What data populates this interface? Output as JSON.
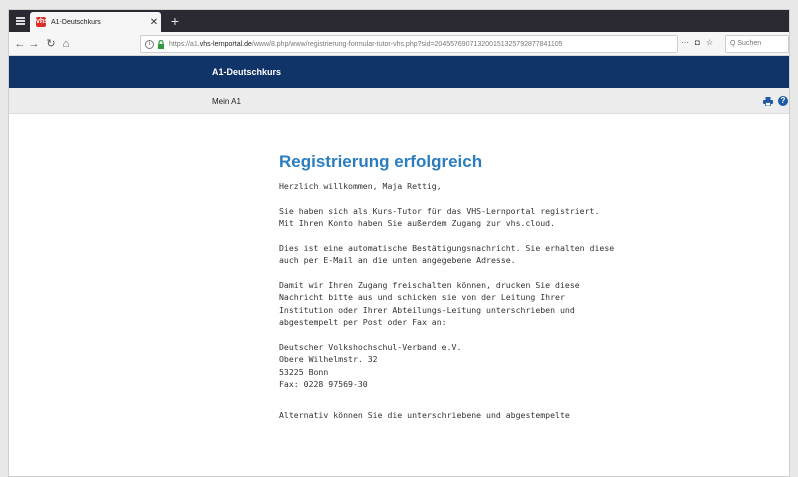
{
  "browser": {
    "tab_title": "A1-Deutschkurs",
    "favicon_text": "vhs",
    "url_prefix": "https://a1.",
    "url_domain": "vhs-lernportal.de",
    "url_rest": "/www/8.php/www/registrierung-formular-tutor-vhs.php?sid=204557690713200151325792877841105",
    "search_placeholder": "Q  Suchen",
    "icons": {
      "menu": "menu-icon",
      "new_tab": "plus-icon",
      "back": "back-arrow-icon",
      "forward": "forward-arrow-icon",
      "reload": "reload-icon",
      "home": "home-icon",
      "page_info": "info-icon",
      "secure": "lock-icon",
      "more": "ellipsis-icon",
      "pocket": "pocket-icon",
      "bookmark": "star-icon"
    }
  },
  "site": {
    "title": "A1-Deutschkurs",
    "nav_link": "Mein A1",
    "header_color": "#113468",
    "accent_color": "#2a7dc0",
    "icons": {
      "print": "print-icon",
      "help": "help-icon"
    }
  },
  "page": {
    "heading": "Registrierung erfolgreich",
    "greeting": "Herzlich willkommen, Maja Rettig,",
    "paragraph1": "Sie haben sich als Kurs-Tutor für das VHS-Lernportal registriert.\nMit Ihren Konto haben Sie außerdem Zugang zur vhs.cloud.",
    "paragraph2": "Dies ist eine automatische Bestätigungsnachricht. Sie erhalten diese\nauch per E-Mail an die unten angegebene Adresse.",
    "paragraph3": "Damit wir Ihren Zugang freischalten können, drucken Sie diese\nNachricht bitte aus und schicken sie von der Leitung Ihrer\nInstitution oder Ihrer Abteilungs-Leitung unterschrieben und\nabgestempelt per Post oder Fax an:",
    "address": "Deutscher Volkshochschul-Verband e.V.\nObere Wilhelmstr. 32\n53225 Bonn\nFax: 0228 97569-30",
    "paragraph4": "Alternativ können Sie die unterschriebene und abgestempelte"
  }
}
